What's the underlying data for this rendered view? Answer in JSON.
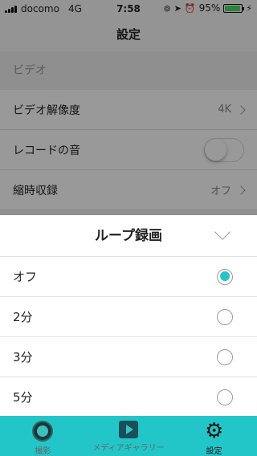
{
  "status": {
    "carrier": "docomo",
    "network": "4G",
    "time": "7:58",
    "battery": "95%",
    "battery_level": 0.95
  },
  "nav": {
    "title": "設定"
  },
  "settings": {
    "section": "ビデオ",
    "rows": [
      {
        "label": "ビデオ解像度",
        "value": "4K"
      },
      {
        "label": "レコードの音"
      },
      {
        "label": "縮時収録",
        "value": "オフ"
      }
    ]
  },
  "sheet": {
    "title": "ループ録画",
    "options": [
      {
        "label": "オフ",
        "selected": true
      },
      {
        "label": "2分",
        "selected": false
      },
      {
        "label": "3分",
        "selected": false
      },
      {
        "label": "5分",
        "selected": false
      }
    ]
  },
  "tabs": [
    {
      "label": "撮影",
      "icon": "camera-icon"
    },
    {
      "label": "メディアギャラリー",
      "icon": "gallery-icon"
    },
    {
      "label": "設定",
      "icon": "gear-icon"
    }
  ],
  "colors": {
    "accent": "#23c6c8",
    "battery": "#4cd964"
  }
}
